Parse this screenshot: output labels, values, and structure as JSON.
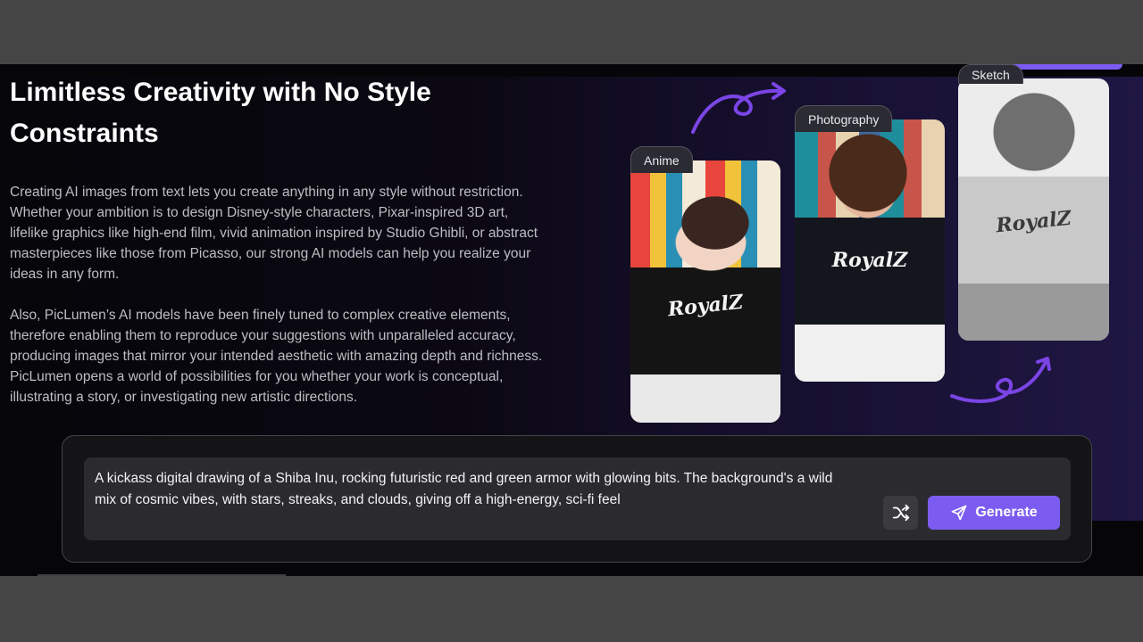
{
  "headline": "Limitless Creativity with No Style Constraints",
  "paragraphs": [
    "Creating AI images from text lets you create anything in any style without restriction. Whether your ambition is to design Disney-style characters, Pixar-inspired 3D art, lifelike graphics like high-end film, vivid animation inspired by Studio Ghibli, or abstract masterpieces like those from Picasso, our strong AI models can help you realize your ideas in any form.",
    "Also, PicLumen’s AI models have been finely tuned to complex creative elements, therefore enabling them to reproduce your suggestions with unparalleled accuracy, producing images that mirror your intended aesthetic with amazing depth and richness. PicLumen opens a world of possibilities for you whether your work is conceptual, illustrating a story, or investigating new artistic directions."
  ],
  "style_cards": [
    {
      "label": "Anime",
      "shirt_text": "RoyalZ"
    },
    {
      "label": "Photography",
      "shirt_text": "RoyalZ"
    },
    {
      "label": "Sketch",
      "shirt_text": "RoyalZ"
    }
  ],
  "prompt": {
    "text": "A kickass digital drawing of a Shiba Inu, rocking futuristic red and green armor with glowing bits. The background's a wild mix of cosmic vibes, with stars, streaks, and clouds, giving off a high-energy, sci-fi feel",
    "shuffle_icon": "shuffle-icon",
    "generate_label": "Generate",
    "generate_icon": "send-icon"
  },
  "colors": {
    "accent": "#7c5cf0",
    "background": "#464545",
    "panel": "#141416"
  }
}
